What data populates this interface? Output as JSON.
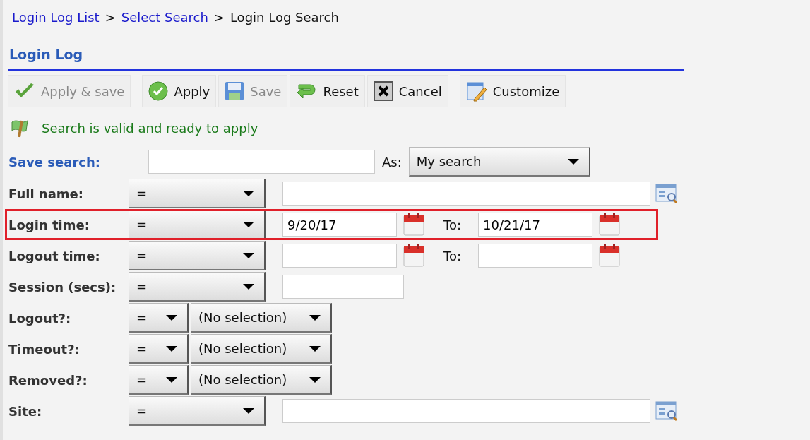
{
  "breadcrumb": [
    {
      "label": "Login Log List",
      "link": true
    },
    {
      "label": ">",
      "link": false
    },
    {
      "label": "Select Search",
      "link": true
    },
    {
      "label": ">",
      "link": false
    },
    {
      "label": "Login Log Search",
      "link": false
    }
  ],
  "heading": "Login Log",
  "toolbar": [
    {
      "buttons": [
        {
          "label": "Apply & save",
          "kind": "check",
          "disabled": true
        }
      ]
    },
    {
      "buttons": [
        {
          "label": "Apply",
          "kind": "apply",
          "disabled": false
        },
        {
          "label": "Save",
          "kind": "save",
          "disabled": true
        },
        {
          "label": "Reset",
          "kind": "reset",
          "disabled": false
        },
        {
          "label": "Cancel",
          "kind": "cancel",
          "disabled": false
        }
      ]
    },
    {
      "buttons": [
        {
          "label": "Customize",
          "kind": "customize",
          "disabled": false
        }
      ]
    }
  ],
  "status": "Search is valid and ready to apply",
  "save_search": {
    "label": "Save search:",
    "as_label": "As:",
    "as_value": "My search"
  },
  "rows": [
    {
      "label": "Full name:",
      "kind": "text",
      "operator": "=",
      "highlighted": false
    },
    {
      "label": "Login time:",
      "kind": "date-range",
      "operator": "=",
      "from": "9/20/17",
      "to_label": "To:",
      "to": "10/21/17",
      "highlighted": true
    },
    {
      "label": "Logout time:",
      "kind": "date-range",
      "operator": "=",
      "to_label": "To:",
      "highlighted": false
    },
    {
      "label": "Session (secs):",
      "kind": "number",
      "operator": "=",
      "highlighted": false
    },
    {
      "label": "Logout?:",
      "kind": "choice",
      "operator": "=",
      "choice": "(No selection)",
      "highlighted": false
    },
    {
      "label": "Timeout?:",
      "kind": "choice",
      "operator": "=",
      "choice": "(No selection)",
      "highlighted": false
    },
    {
      "label": "Removed?:",
      "kind": "choice",
      "operator": "=",
      "choice": "(No selection)",
      "highlighted": false
    },
    {
      "label": "Site:",
      "kind": "text",
      "operator": "=",
      "highlighted": false
    }
  ]
}
